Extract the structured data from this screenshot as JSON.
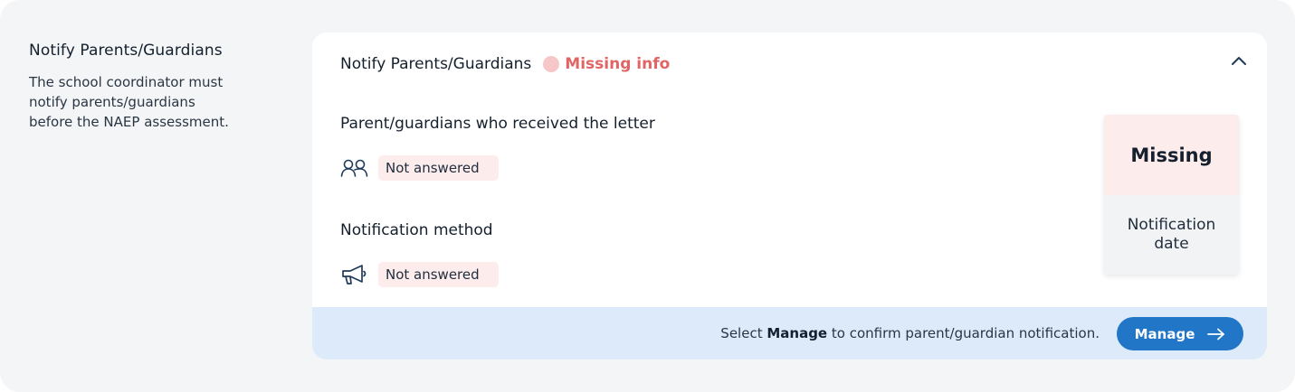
{
  "section": {
    "title": "Notify Parents/Guardians",
    "description": "The school coordinator must notify parents/guardians before the NAEP assessment."
  },
  "card": {
    "title": "Notify Parents/Guardians",
    "status": "Missing info",
    "status_color": "#e26565",
    "collapse_icon": "chevron-up-icon",
    "fields": [
      {
        "label": "Parent/guardians who received the letter",
        "icon": "people-icon",
        "value": "Not answered"
      },
      {
        "label": "Notification method",
        "icon": "megaphone-icon",
        "value": "Not answered"
      }
    ],
    "date_box": {
      "status": "Missing",
      "label": "Notification date"
    },
    "footer": {
      "message_prefix": "Select ",
      "message_bold": "Manage",
      "message_suffix": " to confirm parent/guardian notification.",
      "button_label": "Manage",
      "button_icon": "arrow-right-icon",
      "accent_color": "#2176c7",
      "background_color": "#dceafa"
    }
  }
}
